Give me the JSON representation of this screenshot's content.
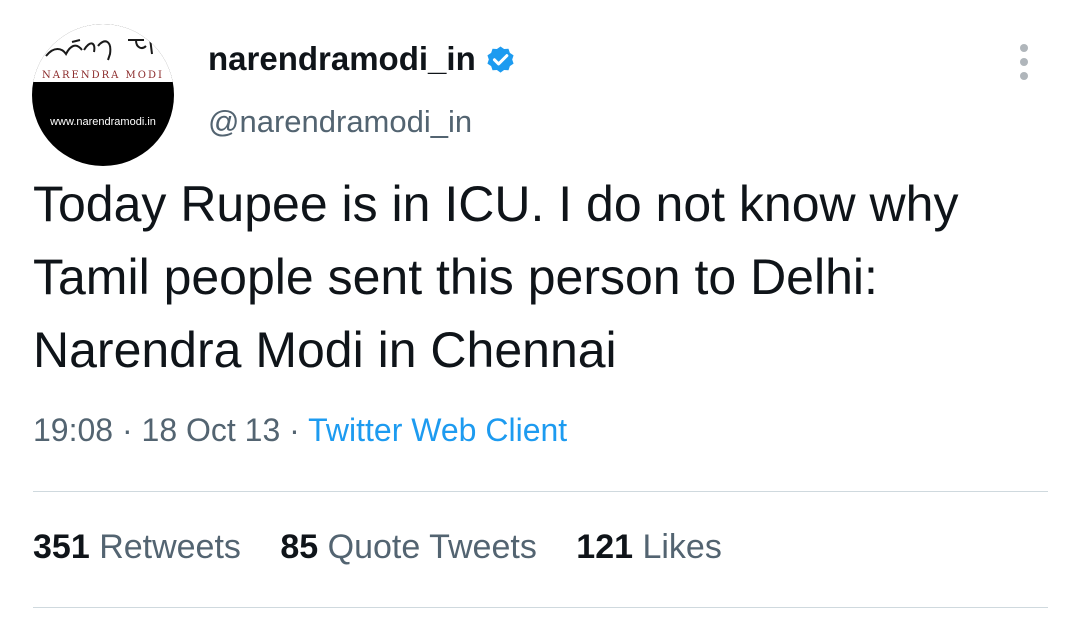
{
  "author": {
    "display_name": "narendramodi_in",
    "handle": "@narendramodi_in",
    "avatar": {
      "logo_text": "NARENDRA MODI",
      "website": "www.narendramodi.in"
    }
  },
  "tweet": {
    "text": "Today Rupee is in ICU. I do not know why Tamil people sent this person to Delhi: Narendra Modi in Chennai",
    "time": "19:08",
    "separator": "·",
    "date": "18 Oct 13",
    "source": "Twitter Web Client"
  },
  "stats": {
    "retweets_count": "351",
    "retweets_label": "Retweets",
    "quotes_count": "85",
    "quotes_label": "Quote Tweets",
    "likes_count": "121",
    "likes_label": "Likes"
  },
  "colors": {
    "link": "#1d9bf0",
    "secondary_text": "#536471",
    "primary_text": "#0f1419",
    "divider": "#cfd9de"
  },
  "icons": {
    "verified": "verified-badge-icon",
    "more": "more-options-icon"
  }
}
